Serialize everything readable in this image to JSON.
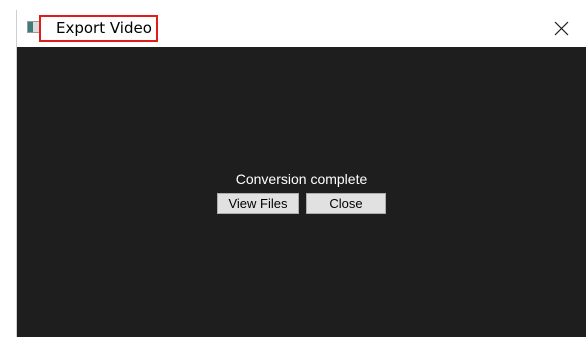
{
  "window": {
    "title": "Export Video",
    "icons": {
      "app": "app-window-icon",
      "close": "close-icon"
    }
  },
  "dialog": {
    "status_text": "Conversion complete",
    "view_files_label": "View Files",
    "close_label": "Close"
  },
  "colors": {
    "background": "#1e1e1e",
    "highlight_border": "#e21b1b",
    "button_face": "#e1e1e1"
  }
}
